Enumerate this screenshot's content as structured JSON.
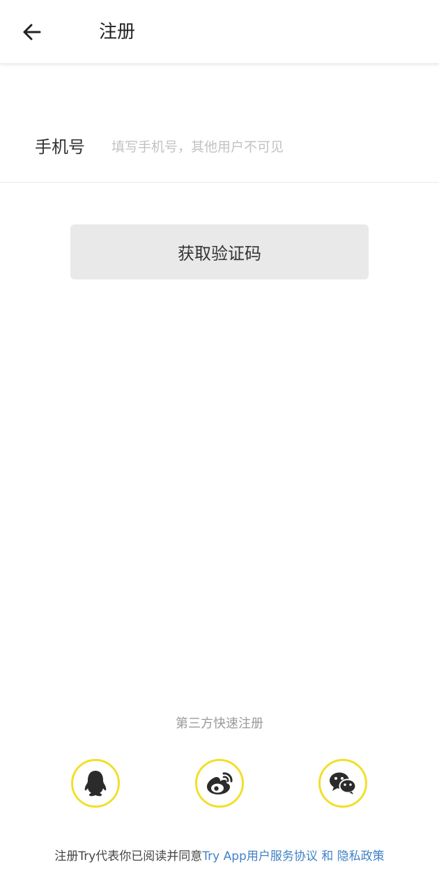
{
  "header": {
    "title": "注册",
    "back_icon": "arrow-left-icon"
  },
  "form": {
    "phone_label": "手机号",
    "phone_placeholder": "填写手机号，其他用户不可见",
    "phone_value": "",
    "get_code_label": "获取验证码"
  },
  "third_party": {
    "title": "第三方快速注册",
    "providers": [
      {
        "name": "qq",
        "icon": "qq-penguin-icon"
      },
      {
        "name": "weibo",
        "icon": "weibo-icon"
      },
      {
        "name": "wechat",
        "icon": "wechat-icon"
      }
    ]
  },
  "agreement": {
    "prefix": "注册Try代表你已阅读并同意",
    "terms_link": "Try App用户服务协议",
    "joiner": " 和 ",
    "privacy_link": "隐私政策"
  },
  "colors": {
    "accent_ring": "#f2df2a",
    "link": "#3f82c6",
    "button_bg": "#e9e9e9",
    "placeholder": "#c2c2c2"
  }
}
